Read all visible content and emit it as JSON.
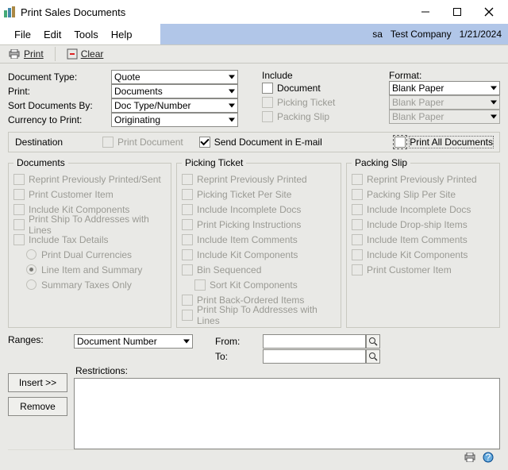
{
  "window": {
    "title": "Print Sales Documents"
  },
  "menu": {
    "file": "File",
    "edit": "Edit",
    "tools": "Tools",
    "help": "Help"
  },
  "context": {
    "user": "sa",
    "company": "Test Company",
    "date": "1/21/2024"
  },
  "toolbar": {
    "print": "Print",
    "clear": "Clear"
  },
  "labels": {
    "doc_type": "Document Type:",
    "print": "Print:",
    "sort": "Sort Documents By:",
    "currency": "Currency to Print:",
    "include": "Include",
    "format": "Format:",
    "destination": "Destination",
    "ranges": "Ranges:",
    "from": "From:",
    "to": "To:",
    "restrictions": "Restrictions:",
    "insert": "Insert >>",
    "remove": "Remove"
  },
  "selects": {
    "doc_type": "Quote",
    "print": "Documents",
    "sort": "Doc Type/Number",
    "currency": "Originating",
    "format1": "Blank Paper",
    "format2": "Blank Paper",
    "format3": "Blank Paper",
    "range": "Document Number"
  },
  "include": {
    "document": "Document",
    "picking_ticket": "Picking Ticket",
    "packing_slip": "Packing Slip"
  },
  "dest": {
    "print_document": "Print Document",
    "send_email": "Send Document in E-mail",
    "print_all": "Print All Documents"
  },
  "documents_group": {
    "legend": "Documents",
    "reprint": "Reprint Previously Printed/Sent",
    "customer_item": "Print Customer Item",
    "kit": "Include Kit Components",
    "ship_to": "Print Ship To Addresses with Lines",
    "tax": "Include Tax Details",
    "dual": "Print Dual Currencies",
    "line_item": "Line Item and Summary",
    "summary": "Summary Taxes Only"
  },
  "picking_group": {
    "legend": "Picking Ticket",
    "reprint": "Reprint Previously Printed",
    "per_site": "Picking Ticket Per Site",
    "incomplete": "Include Incomplete Docs",
    "instructions": "Print Picking Instructions",
    "item_comments": "Include Item Comments",
    "kit": "Include Kit Components",
    "bin": "Bin Sequenced",
    "sort_kit": "Sort Kit Components",
    "back_ordered": "Print Back-Ordered Items",
    "ship_to": "Print Ship To Addresses with Lines"
  },
  "packing_group": {
    "legend": "Packing Slip",
    "reprint": "Reprint Previously Printed",
    "per_site": "Packing Slip Per Site",
    "incomplete": "Include Incomplete Docs",
    "dropship": "Include Drop-ship Items",
    "item_comments": "Include Item Comments",
    "kit": "Include Kit Components",
    "customer_item": "Print Customer Item"
  },
  "range_values": {
    "from": "",
    "to": ""
  }
}
